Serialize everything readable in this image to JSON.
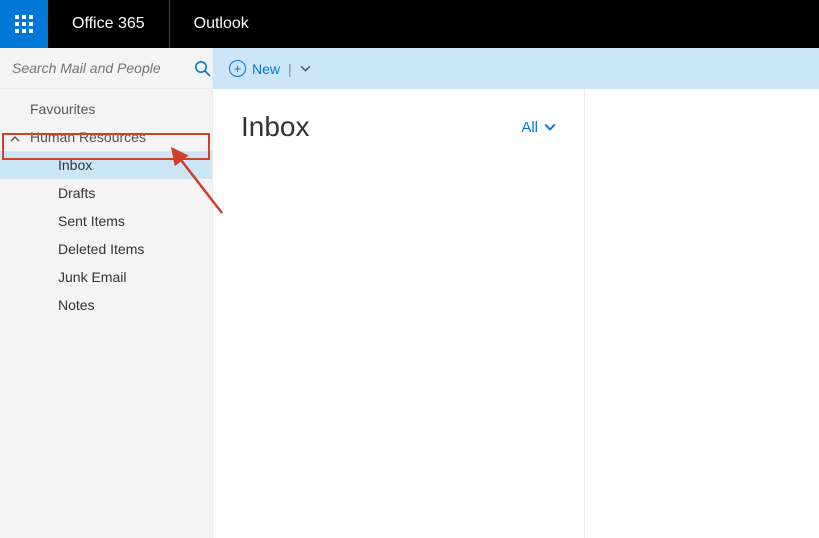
{
  "header": {
    "brand": "Office 365",
    "app": "Outlook"
  },
  "search": {
    "placeholder": "Search Mail and People"
  },
  "toolbar": {
    "new_label": "New"
  },
  "sidebar": {
    "favourites_label": "Favourites",
    "mailbox_label": "Human Resources",
    "folders": [
      {
        "label": "Inbox"
      },
      {
        "label": "Drafts"
      },
      {
        "label": "Sent Items"
      },
      {
        "label": "Deleted Items"
      },
      {
        "label": "Junk Email"
      },
      {
        "label": "Notes"
      }
    ]
  },
  "list": {
    "title": "Inbox",
    "filter_label": "All"
  }
}
